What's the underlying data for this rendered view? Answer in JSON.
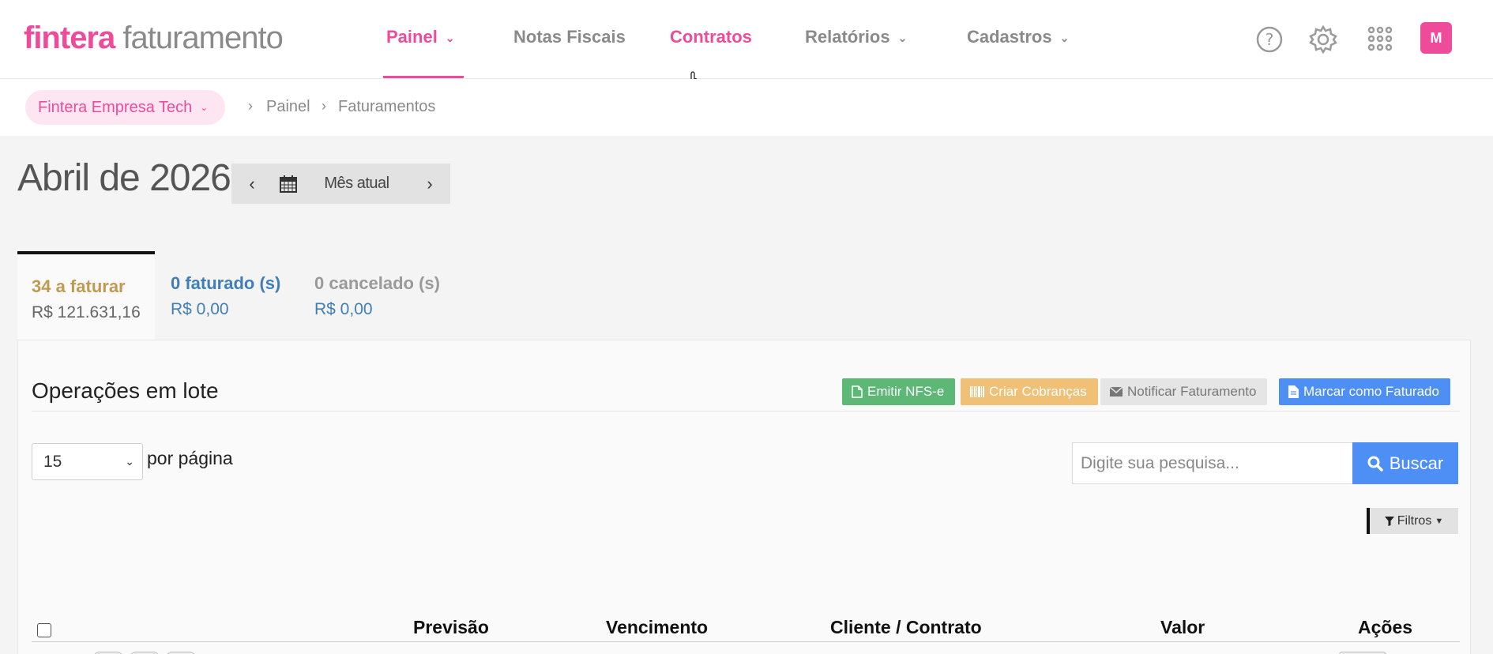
{
  "brand": {
    "name": "fintera",
    "product": "faturamento",
    "accent": "#ee4c9b"
  },
  "nav": {
    "items": [
      {
        "label": "Painel",
        "has_dropdown": true,
        "active": true
      },
      {
        "label": "Notas Fiscais",
        "has_dropdown": false
      },
      {
        "label": "Contratos",
        "has_dropdown": false,
        "hovered": true
      },
      {
        "label": "Relatórios",
        "has_dropdown": true
      },
      {
        "label": "Cadastros",
        "has_dropdown": true
      }
    ],
    "icons": [
      "help-icon",
      "settings-gear-icon",
      "apps-grid-icon"
    ],
    "avatar_initial": "M"
  },
  "breadcrumb": {
    "company": "Fintera Empresa Tech",
    "items": [
      "Painel",
      "Faturamentos"
    ]
  },
  "period": {
    "title": "Abril de 2026",
    "current_label": "Mês atual",
    "prev_icon": "chevron-left-icon",
    "next_icon": "chevron-right-icon",
    "calendar_icon": "calendar-icon"
  },
  "tabs": [
    {
      "label": "34 a faturar",
      "amount": "R$ 121.631,16",
      "color": "#c29950",
      "active": true
    },
    {
      "label": "0 faturado (s)",
      "amount": "R$ 0,00",
      "color": "#3f7fb5"
    },
    {
      "label": "0 cancelado (s)",
      "amount": "R$ 0,00",
      "color": "#9a9a9a"
    }
  ],
  "batch": {
    "title": "Operações em lote",
    "buttons": [
      {
        "label": "Emitir NFS-e",
        "icon": "pdf-file-icon",
        "color": "#5cb874"
      },
      {
        "label": "Criar Cobranças",
        "icon": "barcode-icon",
        "color": "#f0c077"
      },
      {
        "label": "Notificar Faturamento",
        "icon": "envelope-icon",
        "color": "#e5e5e5"
      },
      {
        "label": "Marcar como Faturado",
        "icon": "document-icon",
        "color": "#4e8ff5"
      }
    ]
  },
  "pagination": {
    "per_page": "15",
    "label": "por página"
  },
  "search": {
    "placeholder": "Digite sua pesquisa...",
    "button": "Buscar"
  },
  "filters": {
    "label": "Filtros"
  },
  "table": {
    "columns": [
      "Previsão",
      "Vencimento",
      "Cliente / Contrato",
      "Valor",
      "Ações"
    ]
  }
}
